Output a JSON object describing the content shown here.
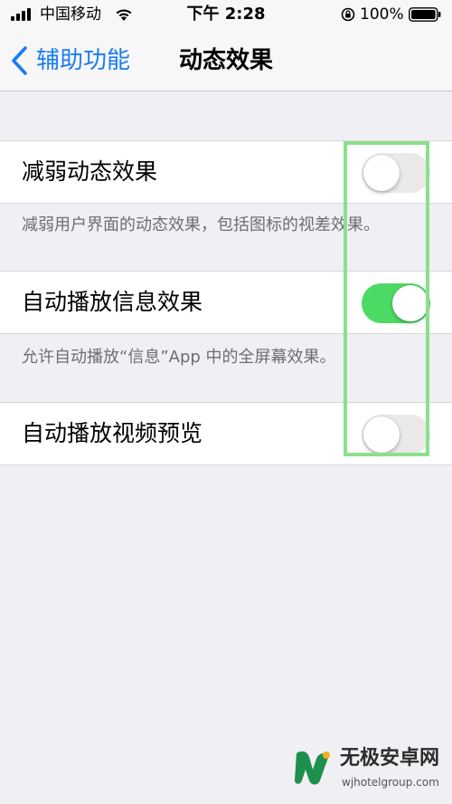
{
  "status_bar": {
    "carrier": "中国移动",
    "time": "下午 2:28",
    "battery": "100%"
  },
  "nav": {
    "back_label": "辅助功能",
    "title": "动态效果"
  },
  "settings": [
    {
      "label": "减弱动态效果",
      "enabled": false,
      "footnote": "减弱用户界面的动态效果，包括图标的视差效果。"
    },
    {
      "label": "自动播放信息效果",
      "enabled": true,
      "footnote": "允许自动播放“信息”App 中的全屏幕效果。"
    },
    {
      "label": "自动播放视频预览",
      "enabled": false
    }
  ],
  "colors": {
    "accent": "#1a7cf5",
    "toggle_on": "#4cd964",
    "highlight": "#8be08b"
  },
  "watermark": {
    "brand": "无极安卓网",
    "url": "wjhotelgroup.com"
  }
}
